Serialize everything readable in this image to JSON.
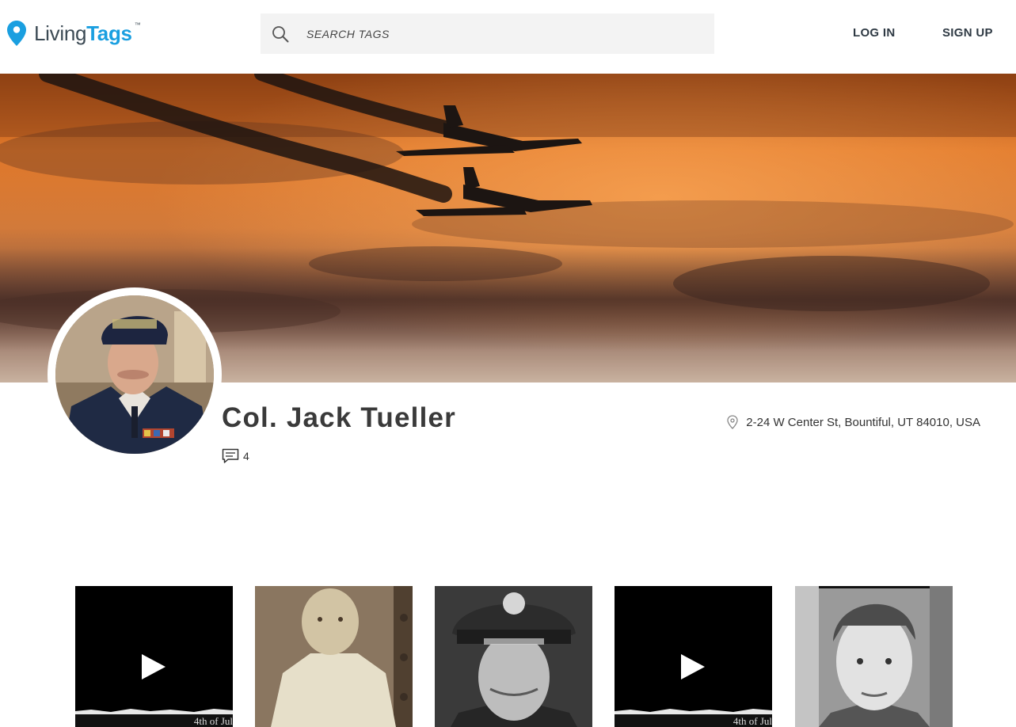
{
  "header": {
    "logo": {
      "living": "Living",
      "tags": "Tags",
      "tm": "™"
    },
    "search": {
      "placeholder": "SEARCH TAGS",
      "value": ""
    },
    "nav": {
      "login": "LOG IN",
      "signup": "SIGN UP"
    }
  },
  "profile": {
    "name": "Col. Jack Tueller",
    "comment_count": "4",
    "location": "2-24 W Center St, Bountiful, UT 84010, USA"
  },
  "gallery": {
    "items": [
      {
        "type": "video",
        "caption": "4th of Jul"
      },
      {
        "type": "photo"
      },
      {
        "type": "photo"
      },
      {
        "type": "video",
        "caption": "4th of Jul"
      },
      {
        "type": "photo"
      }
    ]
  },
  "colors": {
    "brand_blue": "#1a9fe0",
    "text_dark": "#2f3a44",
    "search_bg": "#f3f3f3"
  },
  "icons": [
    "map-pin-logo-icon",
    "search-icon",
    "comment-icon",
    "location-pin-icon",
    "play-icon"
  ]
}
